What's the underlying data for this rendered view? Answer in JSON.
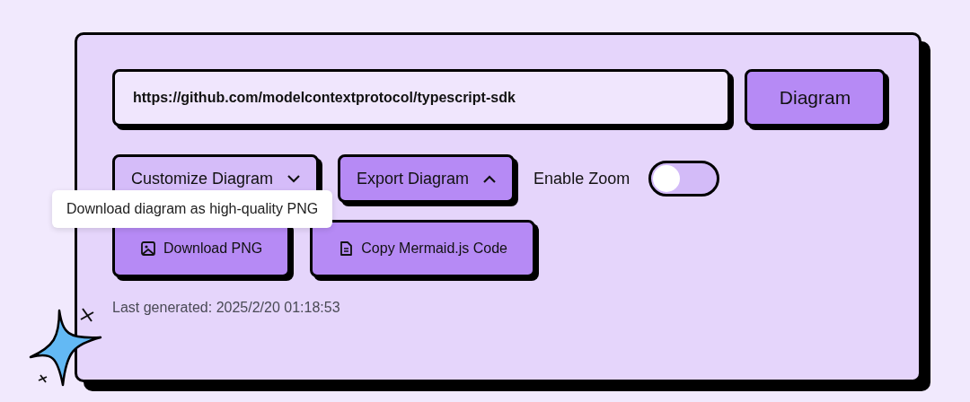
{
  "url_field": {
    "value": "https://github.com/modelcontextprotocol/typescript-sdk"
  },
  "generate_button": {
    "label": "Diagram"
  },
  "dropdowns": [
    {
      "label": "Customize Diagram",
      "expanded": false
    },
    {
      "label": "Export Diagram",
      "expanded": true
    }
  ],
  "zoom_toggle": {
    "label": "Enable Zoom",
    "on": false
  },
  "export_actions": [
    {
      "label": "Download PNG",
      "kind": "image"
    },
    {
      "label": "Copy Mermaid.js Code",
      "kind": "file"
    }
  ],
  "tooltip": {
    "text": "Download diagram as high-quality PNG"
  },
  "last_generated": "Last generated: 2025/2/20 01:18:53"
}
